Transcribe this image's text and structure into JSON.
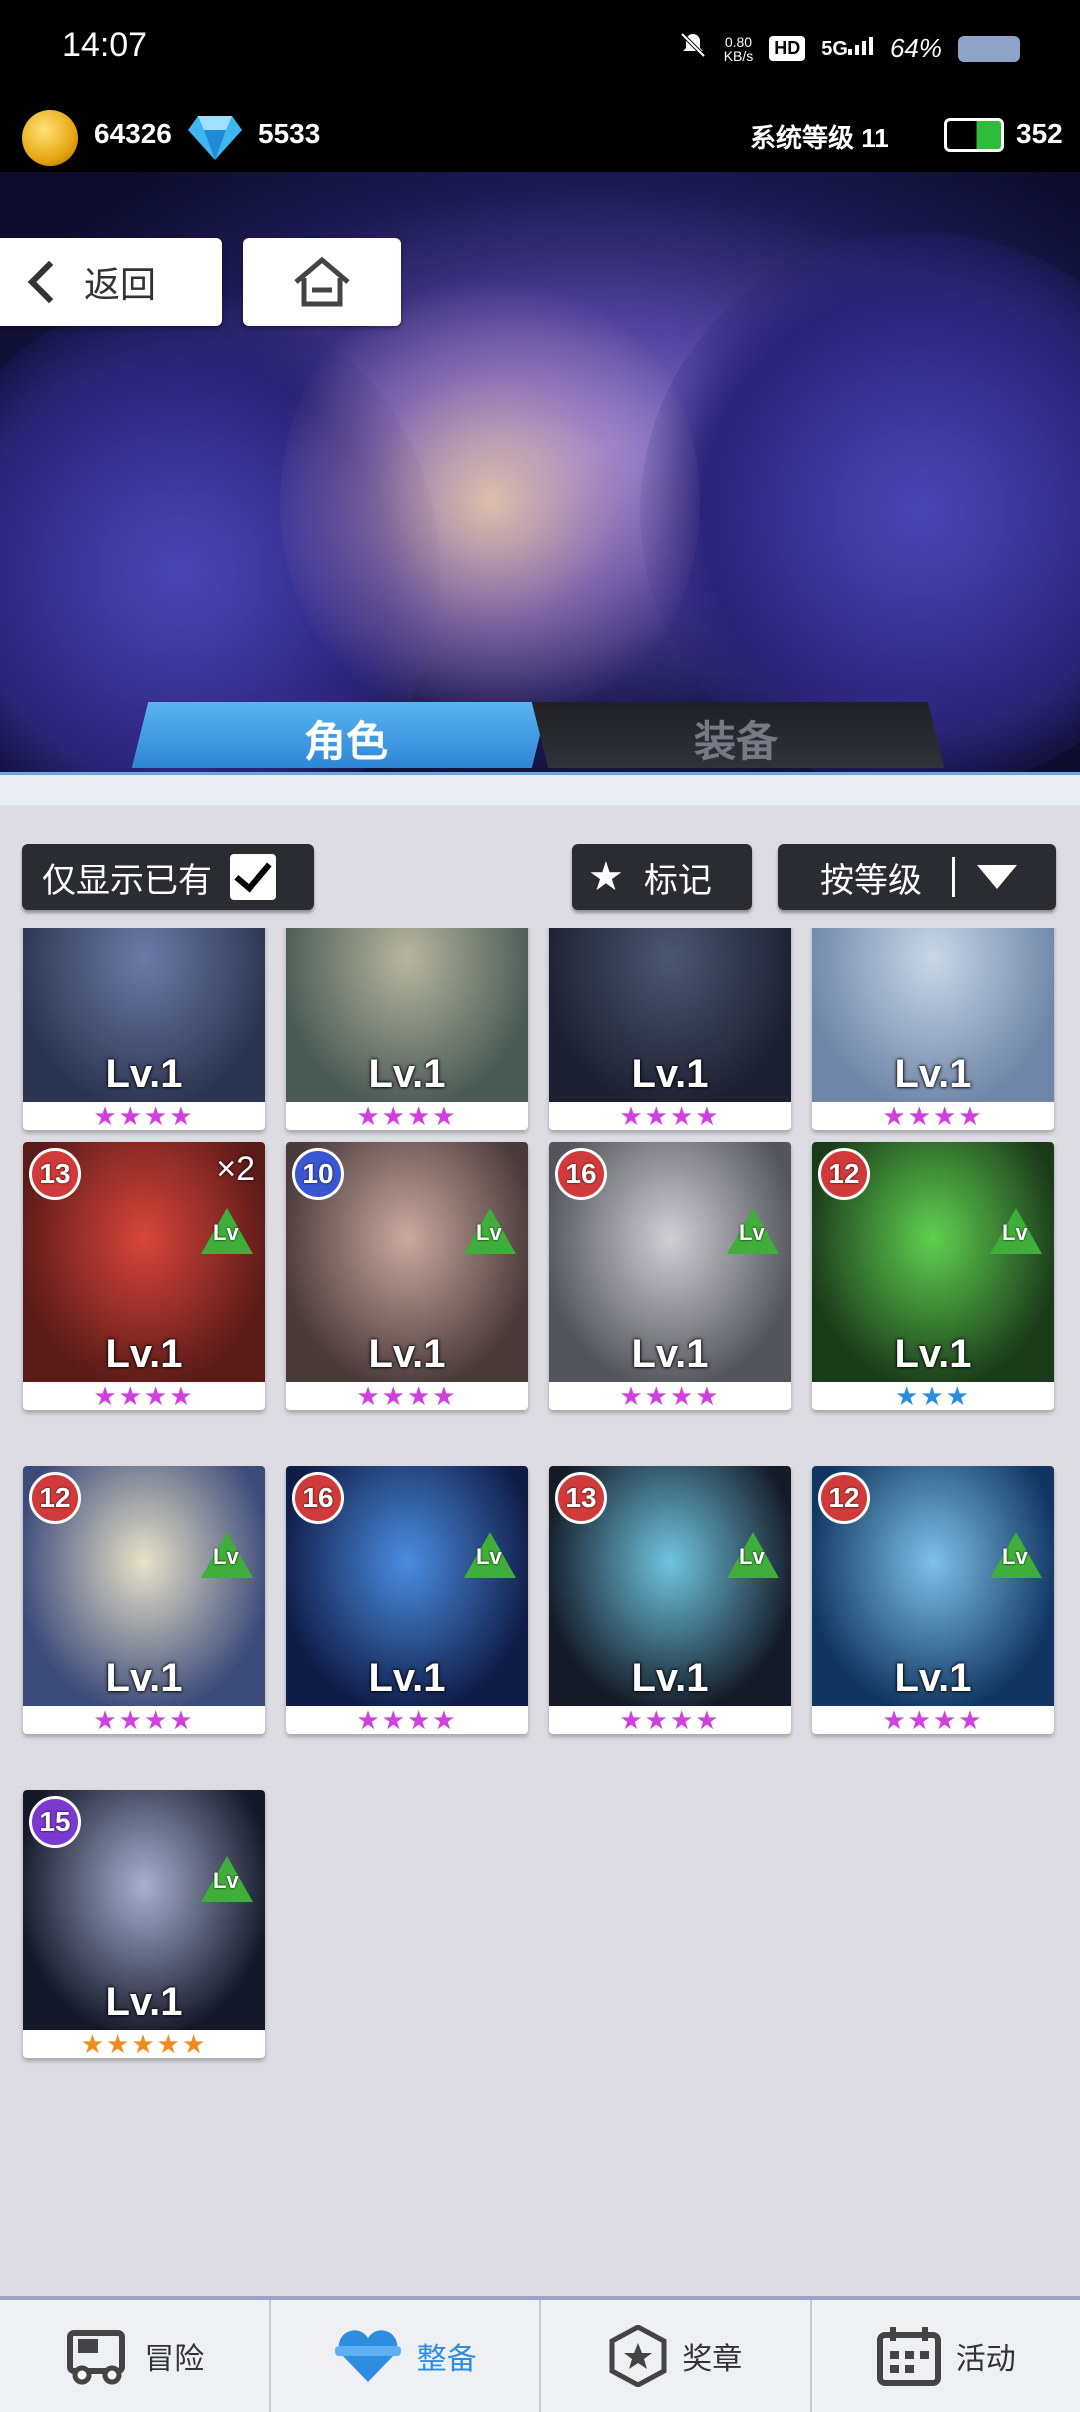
{
  "status_bar": {
    "time": "14:07",
    "net_speed_value": "0.80",
    "net_speed_unit": "KB/s",
    "hd": "HD",
    "network": "5G",
    "battery": "64%"
  },
  "resources": {
    "coins": "64326",
    "gems": "5533",
    "system_level": "系统等级 11",
    "energy": "352"
  },
  "header": {
    "back_label": "返回"
  },
  "tabs": [
    {
      "label": "角色",
      "active": true
    },
    {
      "label": "装备",
      "active": false
    }
  ],
  "filters": {
    "owned_only_label": "仅显示已有",
    "owned_only_checked": true,
    "mark_label": "标记",
    "sort_label": "按等级"
  },
  "cards": [
    {
      "level_text": "Lv.1",
      "stars": "★★★★",
      "star_color": "#d23fe0",
      "rarity_level": null,
      "lv_up": false,
      "art": [
        "#6c7aa8",
        "#2c3550"
      ]
    },
    {
      "level_text": "Lv.1",
      "stars": "★★★★",
      "star_color": "#d23fe0",
      "rarity_level": null,
      "lv_up": false,
      "art": [
        "#b7b6a0",
        "#4a5a55"
      ]
    },
    {
      "level_text": "Lv.1",
      "stars": "★★★★",
      "star_color": "#d23fe0",
      "rarity_level": null,
      "lv_up": false,
      "art": [
        "#4c5670",
        "#1d2030"
      ]
    },
    {
      "level_text": "Lv.1",
      "stars": "★★★★",
      "star_color": "#d23fe0",
      "rarity_level": null,
      "lv_up": false,
      "art": [
        "#c9d7e6",
        "#6f86a8"
      ]
    },
    {
      "level_text": "Lv.1",
      "stars": "★★★★",
      "star_color": "#d23fe0",
      "rarity_level": "13",
      "multiplier": "×2",
      "lv_up": true,
      "art": [
        "#d8453a",
        "#5a1a18"
      ]
    },
    {
      "level_text": "Lv.1",
      "stars": "★★★★",
      "star_color": "#d23fe0",
      "rarity_level": "10",
      "lv_up": true,
      "art": [
        "#c9a9a0",
        "#4a3a3a"
      ]
    },
    {
      "level_text": "Lv.1",
      "stars": "★★★★",
      "star_color": "#d23fe0",
      "rarity_level": "16",
      "lv_up": true,
      "art": [
        "#cfcfd4",
        "#54545c"
      ]
    },
    {
      "level_text": "Lv.1",
      "stars": "★★★",
      "star_color": "#2a8de0",
      "rarity_level": "12",
      "lv_up": true,
      "art": [
        "#5fd050",
        "#1b3a1a"
      ]
    },
    {
      "level_text": "Lv.1",
      "stars": "★★★★",
      "star_color": "#d23fe0",
      "rarity_level": "12",
      "lv_up": true,
      "art": [
        "#e7e2c8",
        "#3c4a7a"
      ]
    },
    {
      "level_text": "Lv.1",
      "stars": "★★★★",
      "star_color": "#d23fe0",
      "rarity_level": "16",
      "lv_up": true,
      "art": [
        "#4a8de0",
        "#101c48"
      ]
    },
    {
      "level_text": "Lv.1",
      "stars": "★★★★",
      "star_color": "#d23fe0",
      "rarity_level": "13",
      "lv_up": true,
      "art": [
        "#6fc4e0",
        "#141a26"
      ]
    },
    {
      "level_text": "Lv.1",
      "stars": "★★★★",
      "star_color": "#d23fe0",
      "rarity_level": "12",
      "lv_up": true,
      "art": [
        "#7ec0e8",
        "#0f3560"
      ]
    },
    {
      "level_text": "Lv.1",
      "stars": "★★★★★",
      "star_color": "#f08c1c",
      "rarity_level": "15",
      "lv_up": true,
      "art": [
        "#a8b0d0",
        "#141828"
      ]
    }
  ],
  "bottom_nav": [
    {
      "label": "冒险",
      "icon": "truck-icon",
      "active": false
    },
    {
      "label": "整备",
      "icon": "heart-gear-icon",
      "active": true
    },
    {
      "label": "奖章",
      "icon": "medal-icon",
      "active": false
    },
    {
      "label": "活动",
      "icon": "calendar-icon",
      "active": false
    }
  ],
  "colors": {
    "accent": "#2f8de0",
    "purple_star": "#d23fe0",
    "gold_star": "#f08c1c",
    "blue_star": "#2a8de0"
  }
}
